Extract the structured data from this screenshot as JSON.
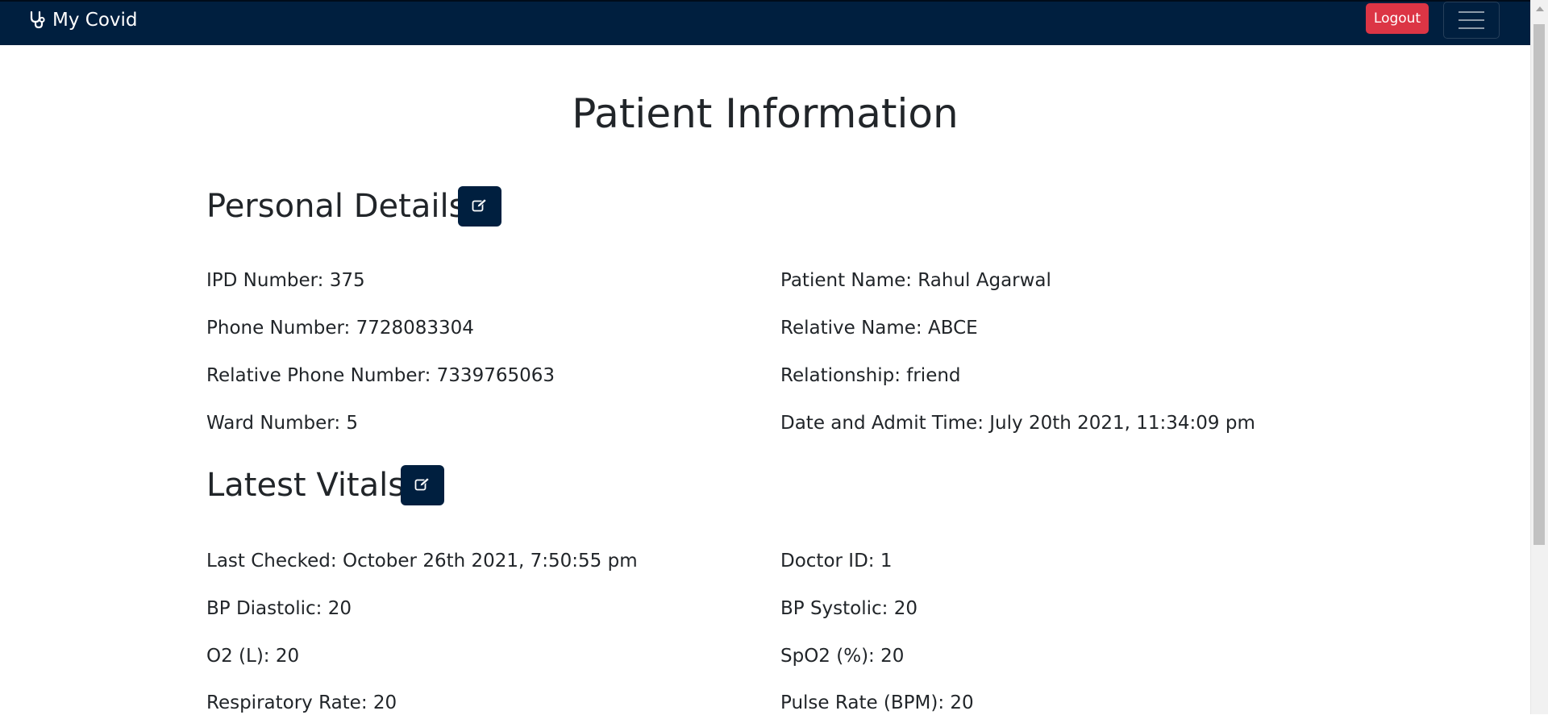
{
  "navbar": {
    "brand": "My Covid",
    "brand_icon": "stethoscope-icon",
    "logout_label": "Logout",
    "menu_icon": "hamburger-menu-icon",
    "colors": {
      "background": "#001f3f",
      "logout": "#dc3545"
    }
  },
  "page": {
    "title": "Patient Information"
  },
  "personal": {
    "title": "Personal Details",
    "edit_icon": "edit-icon",
    "ipd": "IPD Number: 375",
    "patient_name": "Patient Name: Rahul Agarwal",
    "phone": "Phone Number: 7728083304",
    "relative_name": "Relative Name: ABCE",
    "relative_phone": "Relative Phone Number: 7339765063",
    "relationship": "Relationship: friend",
    "ward": "Ward Number: 5",
    "admit_time": "Date and Admit Time: July 20th 2021, 11:34:09 pm"
  },
  "vitals": {
    "title": "Latest Vitals",
    "edit_icon": "edit-icon",
    "last_checked": "Last Checked: October 26th 2021, 7:50:55 pm",
    "doctor_id": "Doctor ID: 1",
    "bp_diastolic": "BP Diastolic: 20",
    "bp_systolic": "BP Systolic: 20",
    "o2": "O2 (L): 20",
    "spo2": "SpO2 (%): 20",
    "respiratory_rate": "Respiratory Rate: 20",
    "pulse_rate": "Pulse Rate (BPM): 20"
  }
}
